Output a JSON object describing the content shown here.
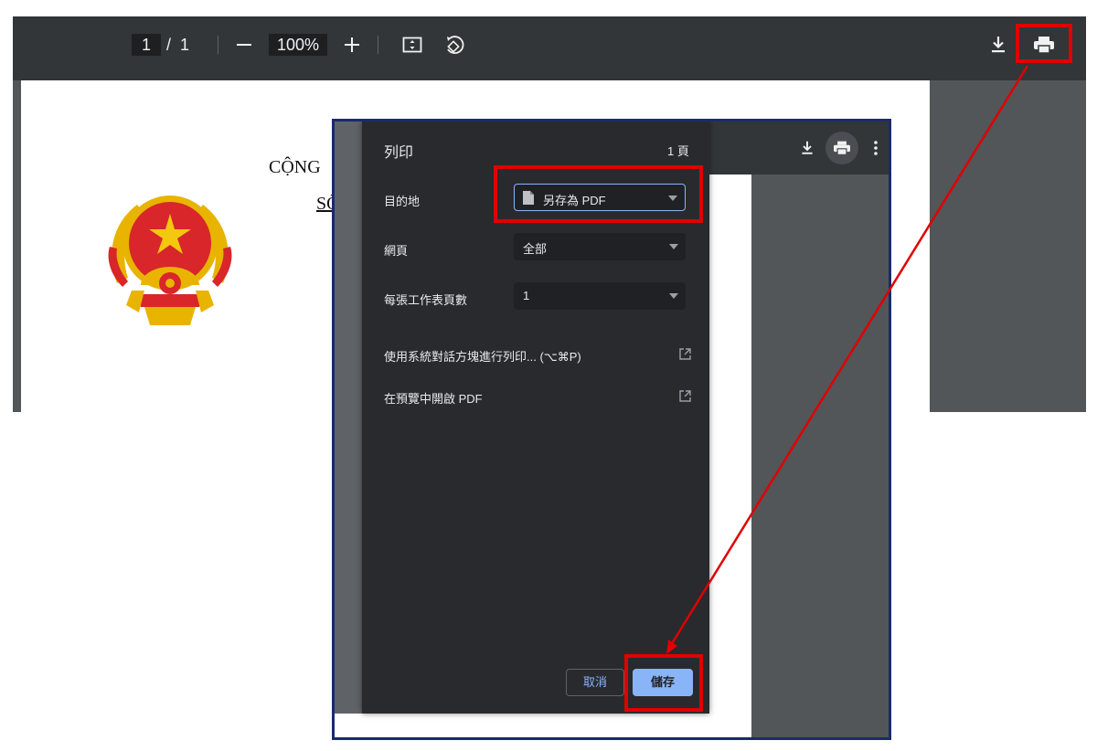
{
  "viewer": {
    "current_page": "1",
    "page_separator": "/",
    "total_pages": "1",
    "zoom": "100%"
  },
  "document": {
    "heading": "CỘNG",
    "sub": "SỐ"
  },
  "dialog": {
    "title": "列印",
    "page_count": "1 頁",
    "destination_label": "目的地",
    "destination_value": "另存為 PDF",
    "pages_label": "網頁",
    "pages_value": "全部",
    "pages_per_sheet_label": "每張工作表頁數",
    "pages_per_sheet_value": "1",
    "system_dialog_link": "使用系統對話方塊進行列印... (⌥⌘P)",
    "open_preview_link": "在預覽中開啟 PDF",
    "cancel_label": "取消",
    "save_label": "儲存"
  },
  "colors": {
    "toolbar_bg": "#323639",
    "dialog_bg": "#292a2d",
    "save_button": "#8ab4f8",
    "highlight": "#e00000",
    "frame_border": "#1a2b6b"
  },
  "icons": [
    "minus-icon",
    "plus-icon",
    "fit-page-icon",
    "rotate-icon",
    "download-icon",
    "print-icon",
    "more-vert-icon",
    "file-icon",
    "open-external-icon",
    "vietnam-emblem"
  ]
}
